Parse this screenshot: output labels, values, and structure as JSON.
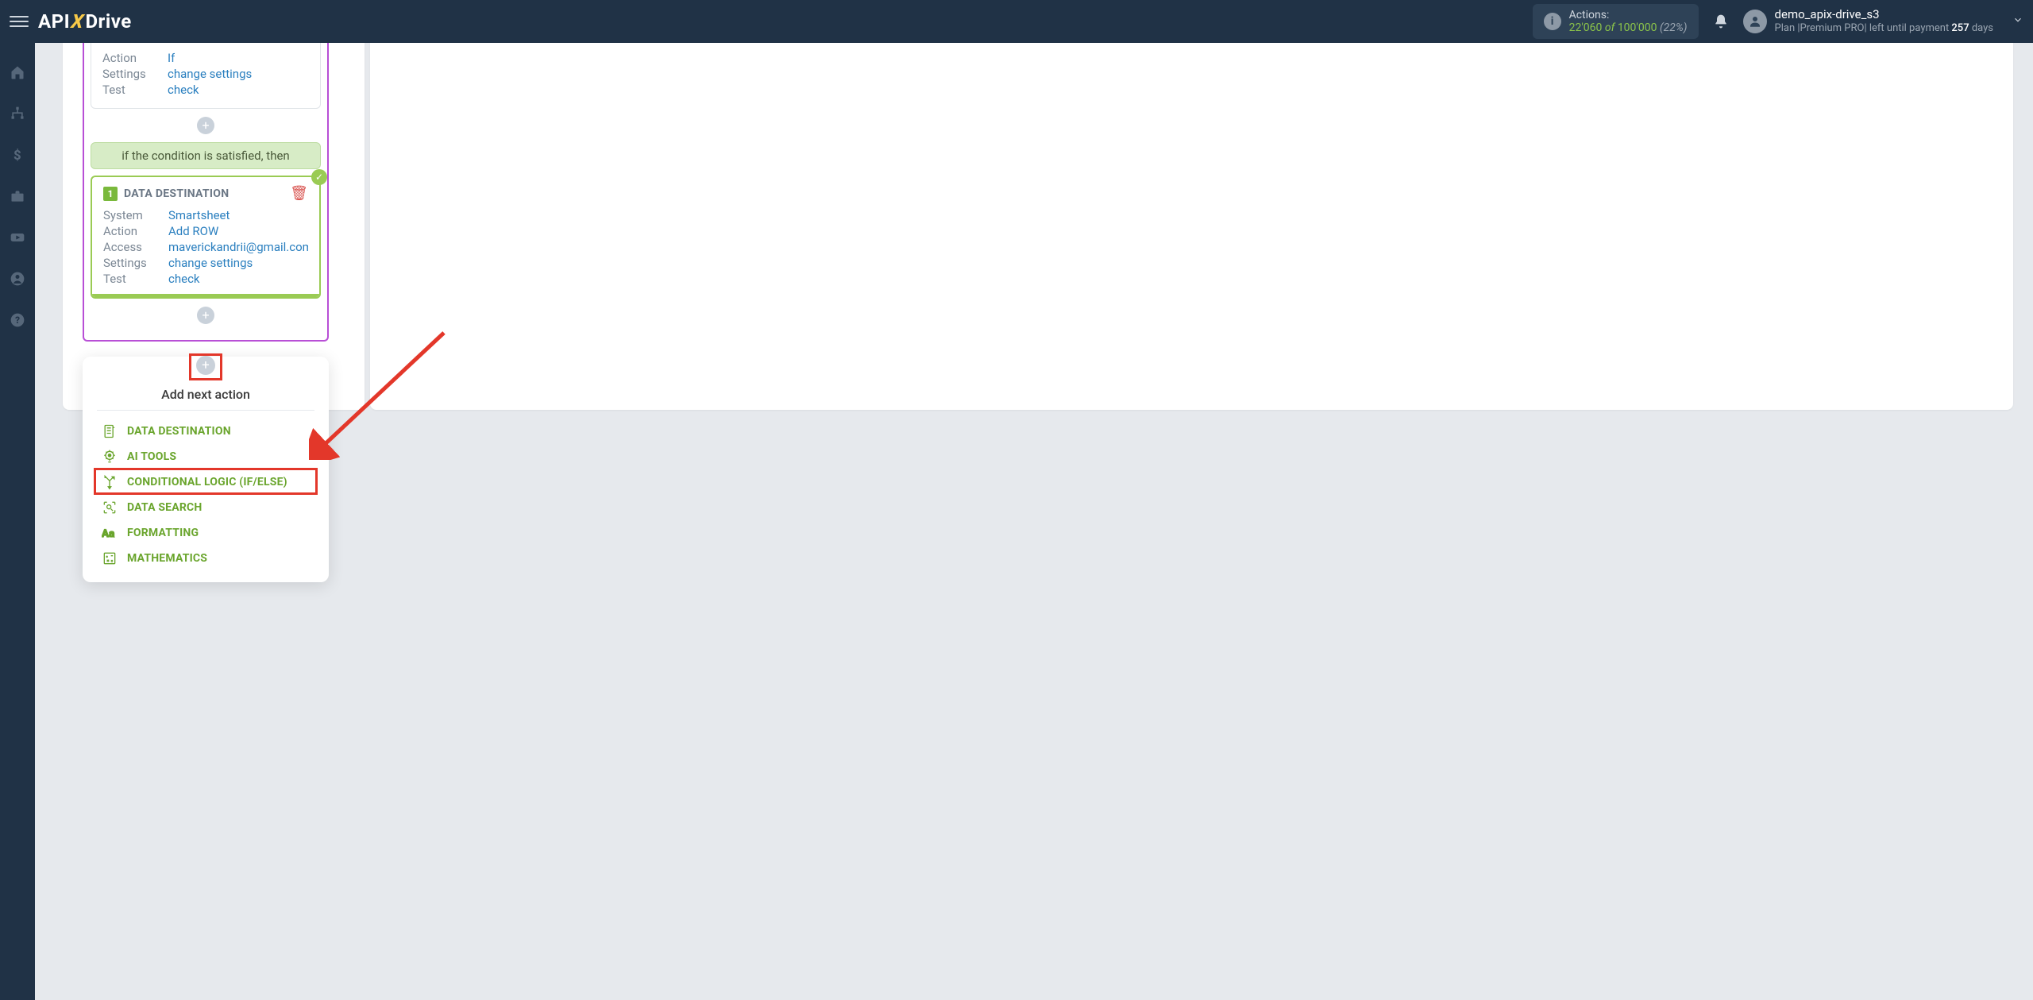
{
  "header": {
    "logo_api": "API",
    "logo_x": "X",
    "logo_drive": "Drive",
    "actions_label": "Actions:",
    "actions_used": "22'060",
    "actions_of": "of",
    "actions_total": "100'000",
    "actions_pct": "(22%)",
    "username": "demo_apix-drive_s3",
    "plan_prefix": "Plan |Premium PRO| left until payment ",
    "plan_days": "257",
    "plan_suffix": " days"
  },
  "card_top": {
    "action_label": "Action",
    "action_value": "If",
    "settings_label": "Settings",
    "settings_value": "change settings",
    "test_label": "Test",
    "test_value": "check"
  },
  "cond_banner": "if the condition is satisfied, then",
  "dest_card": {
    "number": "1",
    "title": "DATA DESTINATION",
    "system_label": "System",
    "system_value": "Smartsheet",
    "action_label": "Action",
    "action_value": "Add ROW",
    "access_label": "Access",
    "access_value": "maverickandrii@gmail.com",
    "settings_label": "Settings",
    "settings_value": "change settings",
    "test_label": "Test",
    "test_value": "check"
  },
  "action_panel": {
    "heading": "Add next action",
    "items": {
      "data_destination": "DATA DESTINATION",
      "ai_tools": "AI TOOLS",
      "conditional_logic": "CONDITIONAL LOGIC (IF/ELSE)",
      "data_search": "DATA SEARCH",
      "formatting": "FORMATTING",
      "mathematics": "MATHEMATICS"
    }
  }
}
